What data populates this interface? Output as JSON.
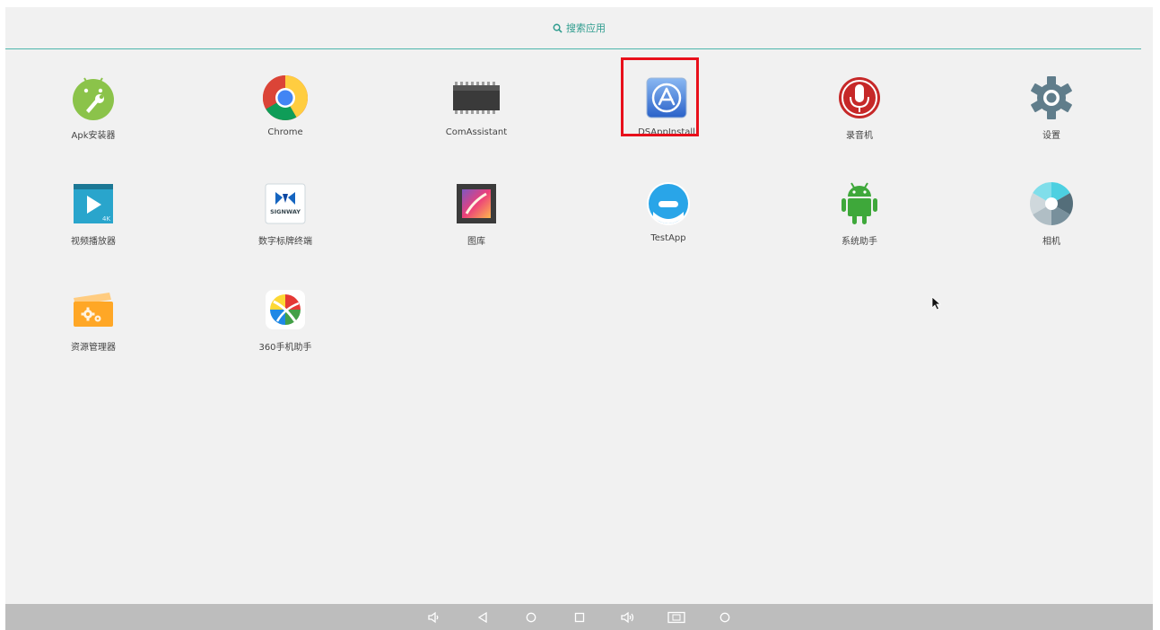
{
  "search": {
    "label": "搜索应用"
  },
  "apps": [
    {
      "label": "Apk安装器",
      "icon": "android-wrench-icon"
    },
    {
      "label": "Chrome",
      "icon": "chrome-icon"
    },
    {
      "label": "ComAssistant",
      "icon": "chip-icon"
    },
    {
      "label": "DSAppInstall",
      "icon": "app-store-icon"
    },
    {
      "label": "录音机",
      "icon": "microphone-icon"
    },
    {
      "label": "设置",
      "icon": "gear-icon"
    },
    {
      "label": "视频播放器",
      "icon": "video-player-icon"
    },
    {
      "label": "数字标牌终端",
      "icon": "signway-logo-icon"
    },
    {
      "label": "图库",
      "icon": "gallery-icon"
    },
    {
      "label": "TestApp",
      "icon": "testapp-face-icon"
    },
    {
      "label": "系统助手",
      "icon": "android-robot-icon"
    },
    {
      "label": "相机",
      "icon": "camera-shutter-icon"
    },
    {
      "label": "资源管理器",
      "icon": "folder-gear-icon"
    },
    {
      "label": "360手机助手",
      "icon": "360-ball-icon"
    }
  ],
  "logo_text": {
    "signway": "SIGNWAY",
    "video_badge": "4K"
  },
  "navbar": [
    {
      "icon": "volume-down-icon"
    },
    {
      "icon": "back-icon"
    },
    {
      "icon": "home-icon"
    },
    {
      "icon": "recents-icon"
    },
    {
      "icon": "volume-up-icon"
    },
    {
      "icon": "screenshot-icon"
    },
    {
      "icon": "power-circle-icon"
    }
  ],
  "colors": {
    "accent": "#2e9c8e",
    "highlight": "#e8101b",
    "navbar": "#bdbdbd",
    "background": "#f1f1f1"
  }
}
